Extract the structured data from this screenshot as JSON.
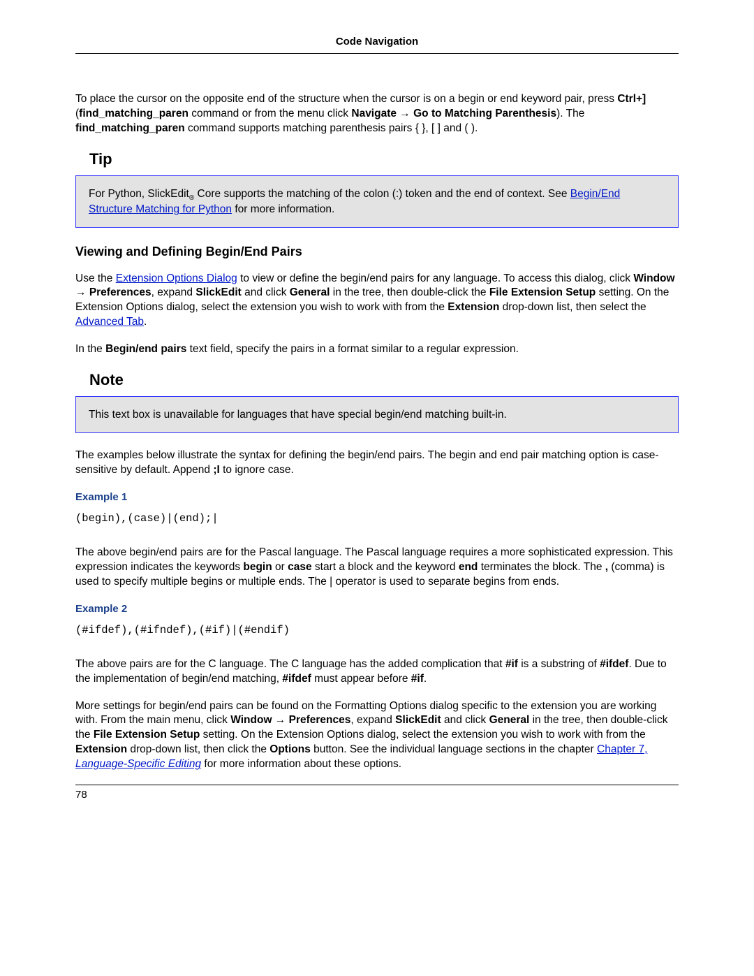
{
  "header": {
    "title": "Code Navigation"
  },
  "intro": {
    "pre_ctrl": "To place the cursor on the opposite end of the structure when the cursor is on a begin or end keyword pair, press ",
    "ctrl": "Ctrl+]",
    "open_paren": " (",
    "cmd1": "find_matching_paren",
    "mid1": " command or from the menu click ",
    "nav": "Navigate",
    "arrow": " → ",
    "goto": "Go to Matching Parenthesis",
    "close_paren": "). The ",
    "cmd2": "find_matching_paren",
    "tail": " command supports matching parenthesis pairs { }, [ ] and ( )."
  },
  "tip": {
    "title": "Tip",
    "p1a": "For Python, SlickEdit",
    "reg": "®",
    "p1b": " Core supports the matching of the colon (:) token and the end of context. See ",
    "link": "Begin/End Structure Matching for Python",
    "p1c": " for more information."
  },
  "section": {
    "heading": "Viewing and Defining Begin/End Pairs"
  },
  "use": {
    "a": "Use the ",
    "link1": "Extension Options Dialog",
    "b": " to view or define the begin/end pairs for any language. To access this dialog, click ",
    "window": "Window",
    "arrow": " → ",
    "prefs": "Preferences",
    "c": ", expand ",
    "slick": "SlickEdit",
    "d": " and click ",
    "general": "General",
    "e": " in the tree, then double-click the ",
    "fes": "File Extension Setup",
    "f": " setting. On the Extension Options dialog, select the extension you wish to work with from the ",
    "ext": "Extension",
    "g": " drop-down list, then select the ",
    "link2": "Advanced Tab",
    "h": "."
  },
  "inthe": {
    "a": "In the ",
    "bep": "Begin/end pairs",
    "b": " text field, specify the pairs in a format similar to a regular expression."
  },
  "note": {
    "title": "Note",
    "body": "This text box is unavailable for languages that have special begin/end matching built-in."
  },
  "examples_intro": {
    "a": "The examples below illustrate the syntax for defining the begin/end pairs. The begin and end pair matching option is case-sensitive by default. Append ",
    "semi": ";I",
    "b": " to ignore case."
  },
  "ex1": {
    "label": "Example 1",
    "code": "(begin),(case)|(end);|",
    "p_a": "The above begin/end pairs are for the Pascal language. The Pascal language requires a more sophisticated expression. This expression indicates the keywords ",
    "begin": "begin",
    "p_b": " or ",
    "case": "case",
    "p_c": " start a block and the keyword ",
    "end": "end",
    "p_d": " terminates the block. The ",
    "comma": ",",
    "p_e": " (comma) is used to specify multiple begins or multiple ends. The | operator is used to separate begins from ends."
  },
  "ex2": {
    "label": "Example 2",
    "code": "(#ifdef),(#ifndef),(#if)|(#endif)",
    "p_a": "The above pairs are for the C language. The C language has the added complication that ",
    "if": "#if",
    "p_b": " is a substring of ",
    "ifdef": "#ifdef",
    "p_c": ". Due to the implementation of begin/end matching, ",
    "ifdef2": "#ifdef",
    "p_d": " must appear before ",
    "if2": "#if",
    "p_e": "."
  },
  "more": {
    "a": "More settings for begin/end pairs can be found on the Formatting Options dialog specific to the extension you are working with. From the main menu, click ",
    "window": "Window",
    "arrow": " → ",
    "prefs": "Preferences",
    "b": ", expand ",
    "slick": "SlickEdit",
    "c": " and click ",
    "general": "General",
    "d": " in the tree, then double-click the ",
    "fes": "File Extension Setup",
    "e": " setting. On the Extension Options dialog, select the extension you wish to work with from the ",
    "ext": "Extension",
    "f": " drop-down list, then click the ",
    "options": "Options",
    "g": " button. See the individual language sections in the chapter ",
    "link_ch": "Chapter 7, ",
    "link_it": "Language-Specific Editing",
    "h": " for more information about these options."
  },
  "footer": {
    "page": "78"
  }
}
